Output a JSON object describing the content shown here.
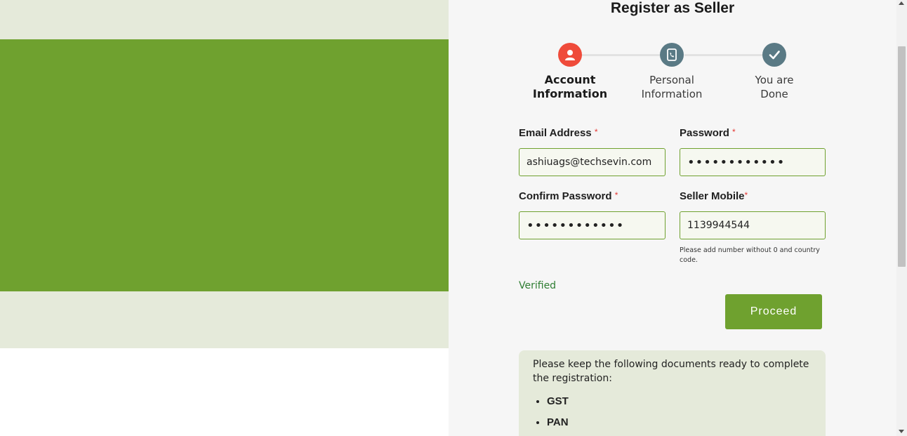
{
  "page": {
    "title": "Register as Seller"
  },
  "steps": [
    {
      "label": "Account Information",
      "icon": "user-icon",
      "color": "#ef4b3a",
      "active": true
    },
    {
      "label": "Personal Information",
      "icon": "phone-icon",
      "color": "#5a7a85",
      "active": false
    },
    {
      "label": "You are Done",
      "icon": "check-icon",
      "color": "#5a7a85",
      "active": false
    }
  ],
  "form": {
    "email": {
      "label": "Email Address",
      "required": "*",
      "value": "ashiuags@techsevin.com"
    },
    "password": {
      "label": "Password",
      "required": "*",
      "value": "••••••••••••"
    },
    "confirm_password": {
      "label": "Confirm Password",
      "required": "*",
      "value": "••••••••••••"
    },
    "mobile": {
      "label": "Seller Mobile",
      "required": "*",
      "value": "1139944544",
      "hint": "Please add number without 0 and country code."
    },
    "status": "Verified",
    "proceed_label": "Proceed"
  },
  "documents": {
    "intro": "Please keep the following documents ready to complete the registration:",
    "items": [
      "GST",
      "PAN"
    ]
  },
  "colors": {
    "brand_green": "#6fa12f",
    "light_green": "#e5eada",
    "active_step": "#ef4b3a",
    "inactive_step": "#5a7a85",
    "verified": "#2e7d32",
    "required": "#e53935"
  }
}
